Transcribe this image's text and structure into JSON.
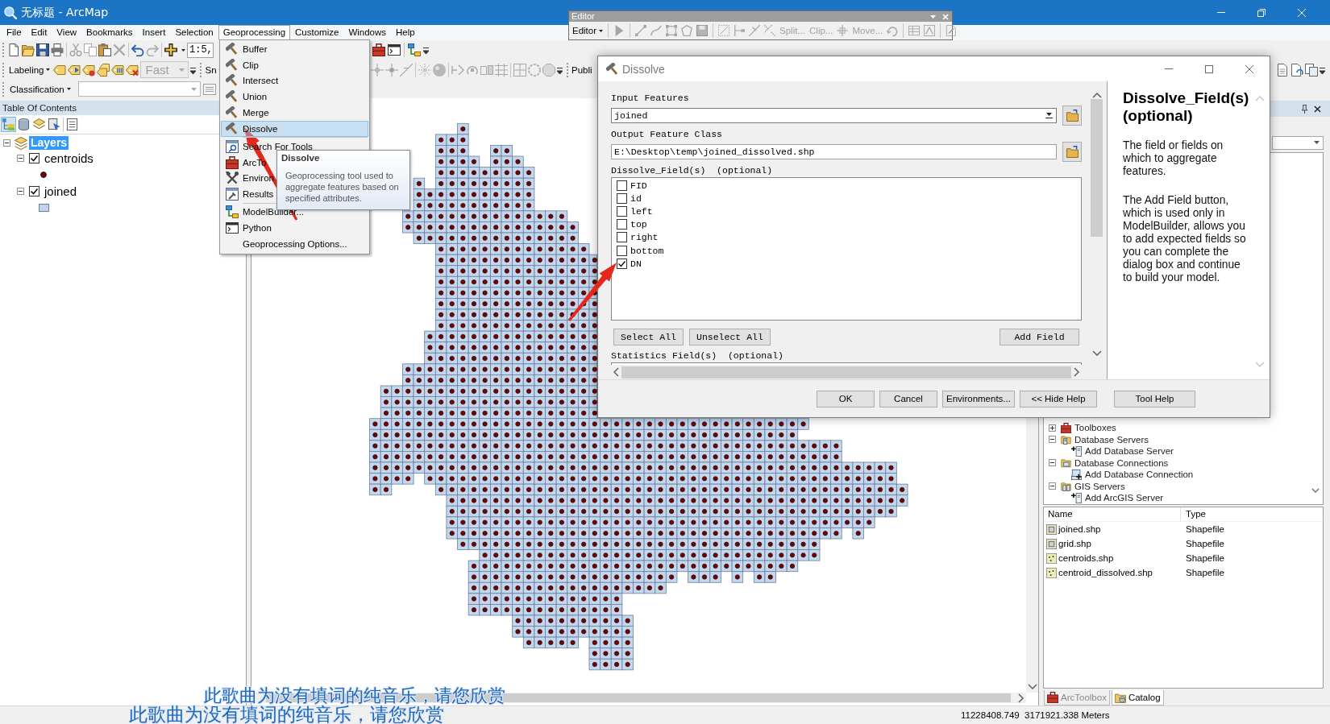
{
  "window": {
    "title": "无标题 - ArcMap"
  },
  "menu_bar": [
    {
      "label": "File",
      "selected": false
    },
    {
      "label": "Edit",
      "selected": false
    },
    {
      "label": "View",
      "selected": false
    },
    {
      "label": "Bookmarks",
      "selected": false
    },
    {
      "label": "Insert",
      "selected": false
    },
    {
      "label": "Selection",
      "selected": false
    },
    {
      "label": "Geoprocessing",
      "selected": true
    },
    {
      "label": "Customize",
      "selected": false
    },
    {
      "label": "Windows",
      "selected": false
    },
    {
      "label": "Help",
      "selected": false
    }
  ],
  "toolbars": {
    "scale": "1:5,",
    "labeling": "Labeling",
    "quality": {
      "value": "Fast",
      "disabled": true
    },
    "snapping": "Sn",
    "publisher": "Publi",
    "classification": "Classification"
  },
  "editor_toolbar": {
    "title": "Editor",
    "menu": "Editor",
    "commands": [
      {
        "label": "Split...",
        "disabled": true
      },
      {
        "label": "Clip...",
        "disabled": true
      },
      {
        "label": "Move...",
        "disabled": true
      }
    ]
  },
  "geoprocessing_menu": {
    "sections": [
      {
        "items": [
          {
            "label": "Buffer",
            "kind": "tool",
            "selected": false
          },
          {
            "label": "Clip",
            "kind": "tool",
            "selected": false
          },
          {
            "label": "Intersect",
            "kind": "tool",
            "selected": false
          },
          {
            "label": "Union",
            "kind": "tool",
            "selected": false
          },
          {
            "label": "Merge",
            "kind": "tool",
            "selected": false
          },
          {
            "label": "Dissolve",
            "kind": "tool",
            "selected": true
          }
        ]
      },
      {
        "items": [
          {
            "label": "Search For Tools",
            "kind": "search",
            "selected": false
          },
          {
            "label": "ArcTo",
            "kind": "toolbox",
            "selected": false
          },
          {
            "label": "Environ",
            "kind": "environments",
            "selected": false
          },
          {
            "label": "Results",
            "kind": "results",
            "selected": false
          }
        ]
      },
      {
        "items": [
          {
            "label": "ModelBuilder...",
            "kind": "model",
            "selected": false
          },
          {
            "label": "Python",
            "kind": "python",
            "selected": false
          },
          {
            "label": "Geoprocessing Options...",
            "kind": "plain",
            "selected": false
          }
        ]
      }
    ]
  },
  "tooltip": {
    "title": "Dissolve",
    "text": "Geoprocessing tool used to aggregate features based on specified attributes."
  },
  "toc": {
    "title": "Table Of Contents",
    "view_modes": [
      {
        "selected": true
      },
      {
        "selected": false
      },
      {
        "selected": false
      },
      {
        "selected": false
      }
    ],
    "layers": {
      "label": "Layers",
      "selected": true,
      "expanded": true,
      "children": [
        {
          "label": "centroids",
          "kind": "point",
          "checked": true,
          "expanded": true
        },
        {
          "label": "joined",
          "kind": "polygon",
          "checked": true,
          "expanded": true
        }
      ]
    }
  },
  "dialog": {
    "title": "Dissolve",
    "input_features": {
      "label": "Input Features",
      "value": "joined"
    },
    "output_feature_class": {
      "label": "Output Feature Class",
      "value": "E:\\Desktop\\temp\\joined_dissolved.shp"
    },
    "dissolve_fields": {
      "label": "Dissolve_Field(s)  (optional)",
      "fields": [
        {
          "label": "FID",
          "checked": false
        },
        {
          "label": "id",
          "checked": false
        },
        {
          "label": "left",
          "checked": false
        },
        {
          "label": "top",
          "checked": false
        },
        {
          "label": "right",
          "checked": false
        },
        {
          "label": "bottom",
          "checked": false
        },
        {
          "label": "DN",
          "checked": true
        }
      ]
    },
    "field_buttons": [
      "Select All",
      "Unselect All",
      "Add Field"
    ],
    "statistics_label": "Statistics Field(s)  (optional)",
    "help": {
      "title": "Dissolve_Field(s) (optional)",
      "paragraphs": [
        "The field or fields on which to aggregate features.",
        "The Add Field button, which is used only in ModelBuilder, allows you to add expected fields so you can complete the dialog box and continue to build your model."
      ]
    },
    "buttons": [
      "OK",
      "Cancel",
      "Environments...",
      "<< Hide Help",
      "Tool Help"
    ]
  },
  "catalog": {
    "tree": [
      {
        "label": "Toolboxes",
        "kind": "toolbox",
        "expanded": false
      },
      {
        "label": "Database Servers",
        "kind": "server-folder",
        "expanded": true,
        "children": [
          {
            "label": "Add Database Server",
            "kind": "add-server"
          }
        ]
      },
      {
        "label": "Database Connections",
        "kind": "connection-folder",
        "expanded": true,
        "children": [
          {
            "label": "Add Database Connection",
            "kind": "add-connection"
          }
        ]
      },
      {
        "label": "GIS Servers",
        "kind": "gis-folder",
        "expanded": true,
        "children": [
          {
            "label": "Add ArcGIS Server",
            "kind": "add-server"
          }
        ]
      }
    ],
    "list": {
      "columns": [
        "Name",
        "Type"
      ],
      "rows": [
        {
          "name": "joined.shp",
          "type": "Shapefile",
          "kind": "polygon"
        },
        {
          "name": "grid.shp",
          "type": "Shapefile",
          "kind": "polygon"
        },
        {
          "name": "centroids.shp",
          "type": "Shapefile",
          "kind": "point"
        },
        {
          "name": "centroid_dissolved.shp",
          "type": "Shapefile",
          "kind": "point"
        }
      ]
    },
    "tabs": [
      {
        "label": "ArcToolbox",
        "kind": "toolbox",
        "selected": false
      },
      {
        "label": "Catalog",
        "kind": "catalog",
        "selected": true
      }
    ]
  },
  "status_bar": {
    "coordinates": "11228408.749  3171921.338 Meters"
  },
  "captions": [
    "此歌曲为没有填词的纯音乐，请您欣赏",
    "此歌曲为没有填词的纯音乐，请您欣赏"
  ]
}
